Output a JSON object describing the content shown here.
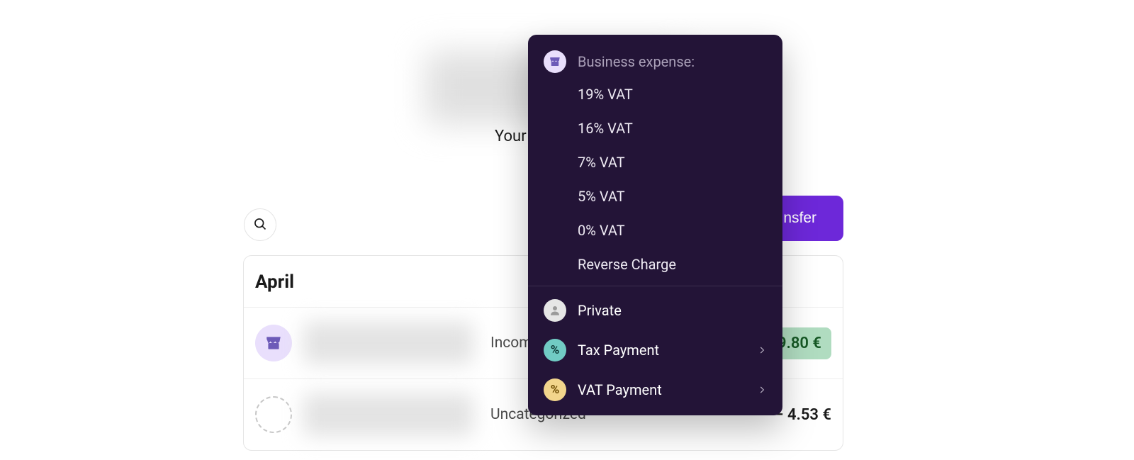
{
  "header": {
    "subtitle_fragment": "Your",
    "transfer_button_fragment": "nsfer"
  },
  "search": {},
  "transactions": {
    "month_header": "April",
    "rows": [
      {
        "category": "Incom",
        "amount_fragment": "9.80 €",
        "style": "positive",
        "icon": "store"
      },
      {
        "category": "Uncategorized",
        "amount": "– 4.53 €",
        "style": "negative",
        "icon": "dashed"
      }
    ]
  },
  "popup": {
    "business_expense_label": "Business expense:",
    "vat_options": [
      "19% VAT",
      "16% VAT",
      "7% VAT",
      "5% VAT",
      "0% VAT",
      "Reverse Charge"
    ],
    "private_label": "Private",
    "tax_payment_label": "Tax Payment",
    "vat_payment_label": "VAT Payment",
    "percent_glyph": "%"
  }
}
